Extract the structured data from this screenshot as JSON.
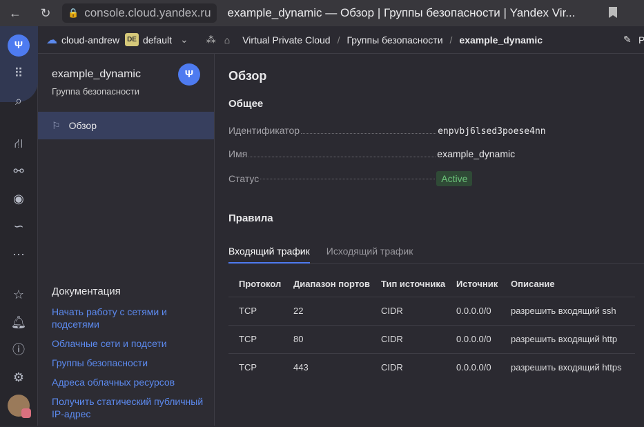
{
  "browser": {
    "url": "console.cloud.yandex.ru",
    "title": "example_dynamic — Обзор | Группы безопасности | Yandex Vir..."
  },
  "header": {
    "cloud": "cloud-andrew",
    "folder_badge": "DE",
    "folder": "default",
    "breadcrumb": [
      "Virtual Private Cloud",
      "Группы безопасности",
      "example_dynamic"
    ],
    "edit_partial": "P"
  },
  "sidebar": {
    "title": "example_dynamic",
    "subtitle": "Группа безопасности",
    "nav": [
      {
        "label": "Обзор",
        "icon": "flag-icon"
      }
    ],
    "docs_title": "Документация",
    "docs": [
      "Начать работу с сетями и подсетями",
      "Облачные сети и подсети",
      "Группы безопасности",
      "Адреса облачных ресурсов",
      "Получить статический публичный IP-адрес"
    ]
  },
  "main": {
    "title": "Обзор",
    "general": "Общее",
    "fields": [
      {
        "label": "Идентификатор",
        "value": "enpvbj6lsed3poese4nn"
      },
      {
        "label": "Имя",
        "value": "example_dynamic"
      },
      {
        "label": "Статус",
        "value": "Active"
      }
    ],
    "rules_title": "Правила",
    "tabs": [
      "Входящий трафик",
      "Исходящий трафик"
    ],
    "columns": [
      "Протокол",
      "Диапазон портов",
      "Тип источника",
      "Источник",
      "Описание"
    ],
    "rows": [
      [
        "TCP",
        "22",
        "CIDR",
        "0.0.0.0/0",
        "разрешить входящий ssh"
      ],
      [
        "TCP",
        "80",
        "CIDR",
        "0.0.0.0/0",
        "разрешить входящий http"
      ],
      [
        "TCP",
        "443",
        "CIDR",
        "0.0.0.0/0",
        "разрешить входящий https"
      ]
    ]
  },
  "colors": {
    "accent": "#4e7bf0",
    "link": "#5c8aef",
    "status_bg": "#2f4a36",
    "status_text": "#6cc47a"
  }
}
